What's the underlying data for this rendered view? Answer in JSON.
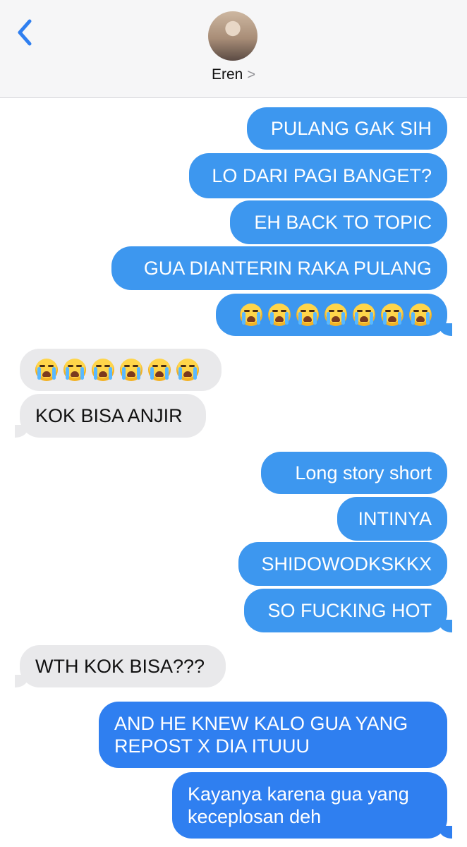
{
  "header": {
    "back_icon": "chevron-left-icon",
    "contact_name": "Eren",
    "contact_chevron": ">"
  },
  "messages": [
    {
      "dir": "out",
      "text": "PULANG GAK SIH"
    },
    {
      "dir": "out",
      "text": "LO DARI PAGI BANGET?"
    },
    {
      "dir": "out",
      "text": "EH BACK TO TOPIC"
    },
    {
      "dir": "out",
      "text": "GUA DIANTERIN RAKA PULANG"
    },
    {
      "dir": "out",
      "emoji": "loudly-crying-face",
      "count": 7
    },
    {
      "dir": "in",
      "emoji": "loudly-crying-face",
      "count": 6
    },
    {
      "dir": "in",
      "text": "KOK BISA ANJIR"
    },
    {
      "dir": "out",
      "text": "Long story short"
    },
    {
      "dir": "out",
      "text": "INTINYA"
    },
    {
      "dir": "out",
      "text": "SHIDOWODKSKKX"
    },
    {
      "dir": "out",
      "text": "SO FUCKING HOT"
    },
    {
      "dir": "in",
      "text": "WTH KOK BISA???"
    },
    {
      "dir": "out",
      "text": "AND HE KNEW KALO GUA YANG REPOST X DIA ITUUU"
    },
    {
      "dir": "out",
      "text": "Kayanya karena gua yang keceplosan deh"
    }
  ],
  "colors": {
    "outgoing_bubble": "#3d97ef",
    "outgoing_bubble_latest": "#2f7ff0",
    "incoming_bubble": "#e9e9eb",
    "header_bg": "#f6f6f7",
    "accent": "#2f7ff0"
  }
}
